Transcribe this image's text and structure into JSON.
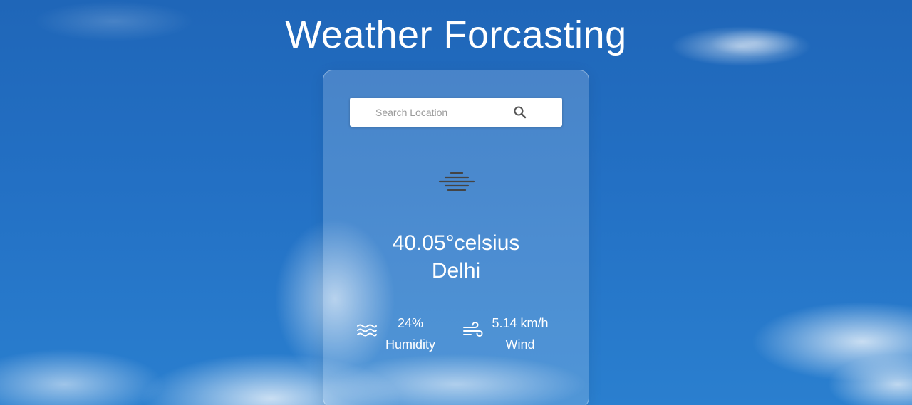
{
  "header": {
    "title": "Weather Forcasting"
  },
  "search": {
    "placeholder": "Search Location",
    "value": "",
    "icon": "search-icon"
  },
  "weather": {
    "icon": "haze-icon",
    "temperature": "40.05°celsius",
    "city": "Delhi"
  },
  "stats": {
    "humidity": {
      "icon": "humidity-waves-icon",
      "value": "24%",
      "label": "Humidity"
    },
    "wind": {
      "icon": "wind-icon",
      "value": "5.14 km/h",
      "label": "Wind"
    }
  },
  "colors": {
    "sky": "#2370c4",
    "text": "#ffffff",
    "icon_dark": "#444444"
  }
}
